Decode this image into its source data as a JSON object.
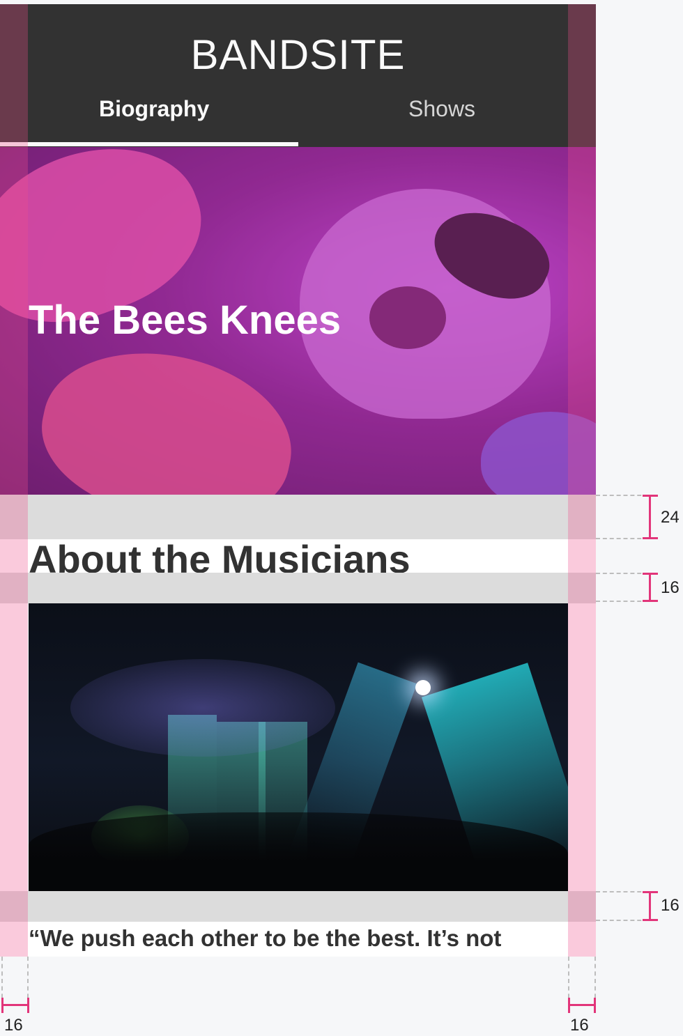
{
  "header": {
    "brand": "BANDSITE",
    "tabs": [
      {
        "label": "Biography",
        "active": true
      },
      {
        "label": "Shows",
        "active": false
      }
    ]
  },
  "hero": {
    "title": "The Bees Knees"
  },
  "about": {
    "title": "About the Musicians",
    "quote": "“We push each other to be the best. It’s not"
  },
  "annotations": {
    "spacing_top": "24",
    "spacing_after_title": "16",
    "spacing_after_image": "16",
    "gutter_left": "16",
    "gutter_right": "16"
  },
  "colors": {
    "header_bg": "#323232",
    "text_dark": "#323232",
    "gutter_overlay": "#f0508c",
    "dimension_marker": "#e2357a",
    "spacer_gray": "#dcdcdc"
  },
  "icons": {
    "hero_image": "flowers-bee-photo",
    "concert_image": "concert-stage-photo"
  }
}
